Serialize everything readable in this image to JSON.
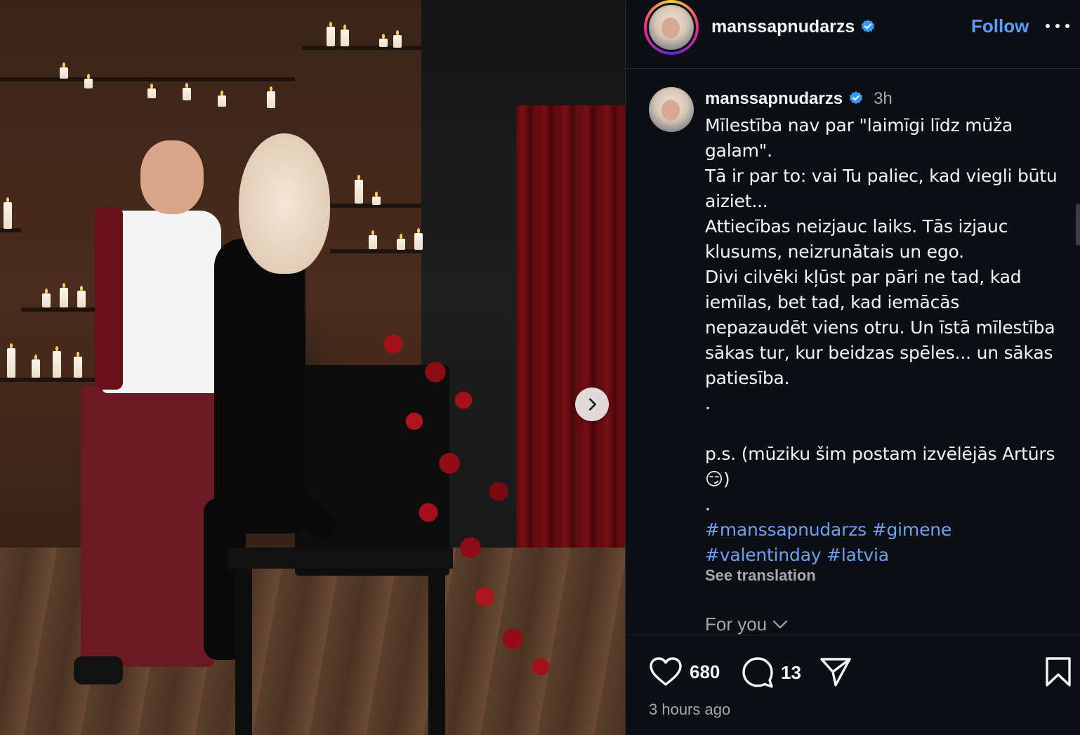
{
  "post": {
    "username": "manssapnudarzs",
    "follow_label": "Follow",
    "caption_time": "3h",
    "caption_lines": [
      "Mīlestība nav par \"laimīgi līdz mūža",
      "galam\".",
      "Tā ir par to: vai Tu paliec, kad viegli būtu",
      "aiziet...",
      "Attiecības neizjauc laiks. Tās izjauc",
      "klusums, neizrunātais un ego.",
      "Divi cilvēki kļūst par pāri ne tad, kad",
      "iemīlas, bet tad, kad iemācās",
      "nepazaudēt viens otru. Un īstā mīlestība",
      "sākas tur, kur beidzas spēles... un sākas",
      "patiesība.",
      ".",
      "",
      "p.s. (mūziku šim postam izvēlējās Artūrs",
      "😏)",
      "."
    ],
    "hashtags_line1": [
      "#manssapnudarzs",
      "#gimene"
    ],
    "hashtags_line2": [
      "#valentinday",
      "#latvia"
    ],
    "see_translation": "See translation",
    "for_you": "For you",
    "likes": "680",
    "comments": "13",
    "time_ago": "3 hours ago"
  },
  "icons": {
    "verified": "verified-badge-icon",
    "more": "more-options-icon",
    "next": "chevron-right-icon",
    "like": "heart-icon",
    "comment": "comment-icon",
    "share": "share-icon",
    "save": "bookmark-icon",
    "for_you_chevron": "chevron-down-icon"
  },
  "colors": {
    "accent": "#5c9bf6",
    "hashtag": "#6f9ff5",
    "muted": "#a8a8a8",
    "background": "#0c0f14"
  }
}
